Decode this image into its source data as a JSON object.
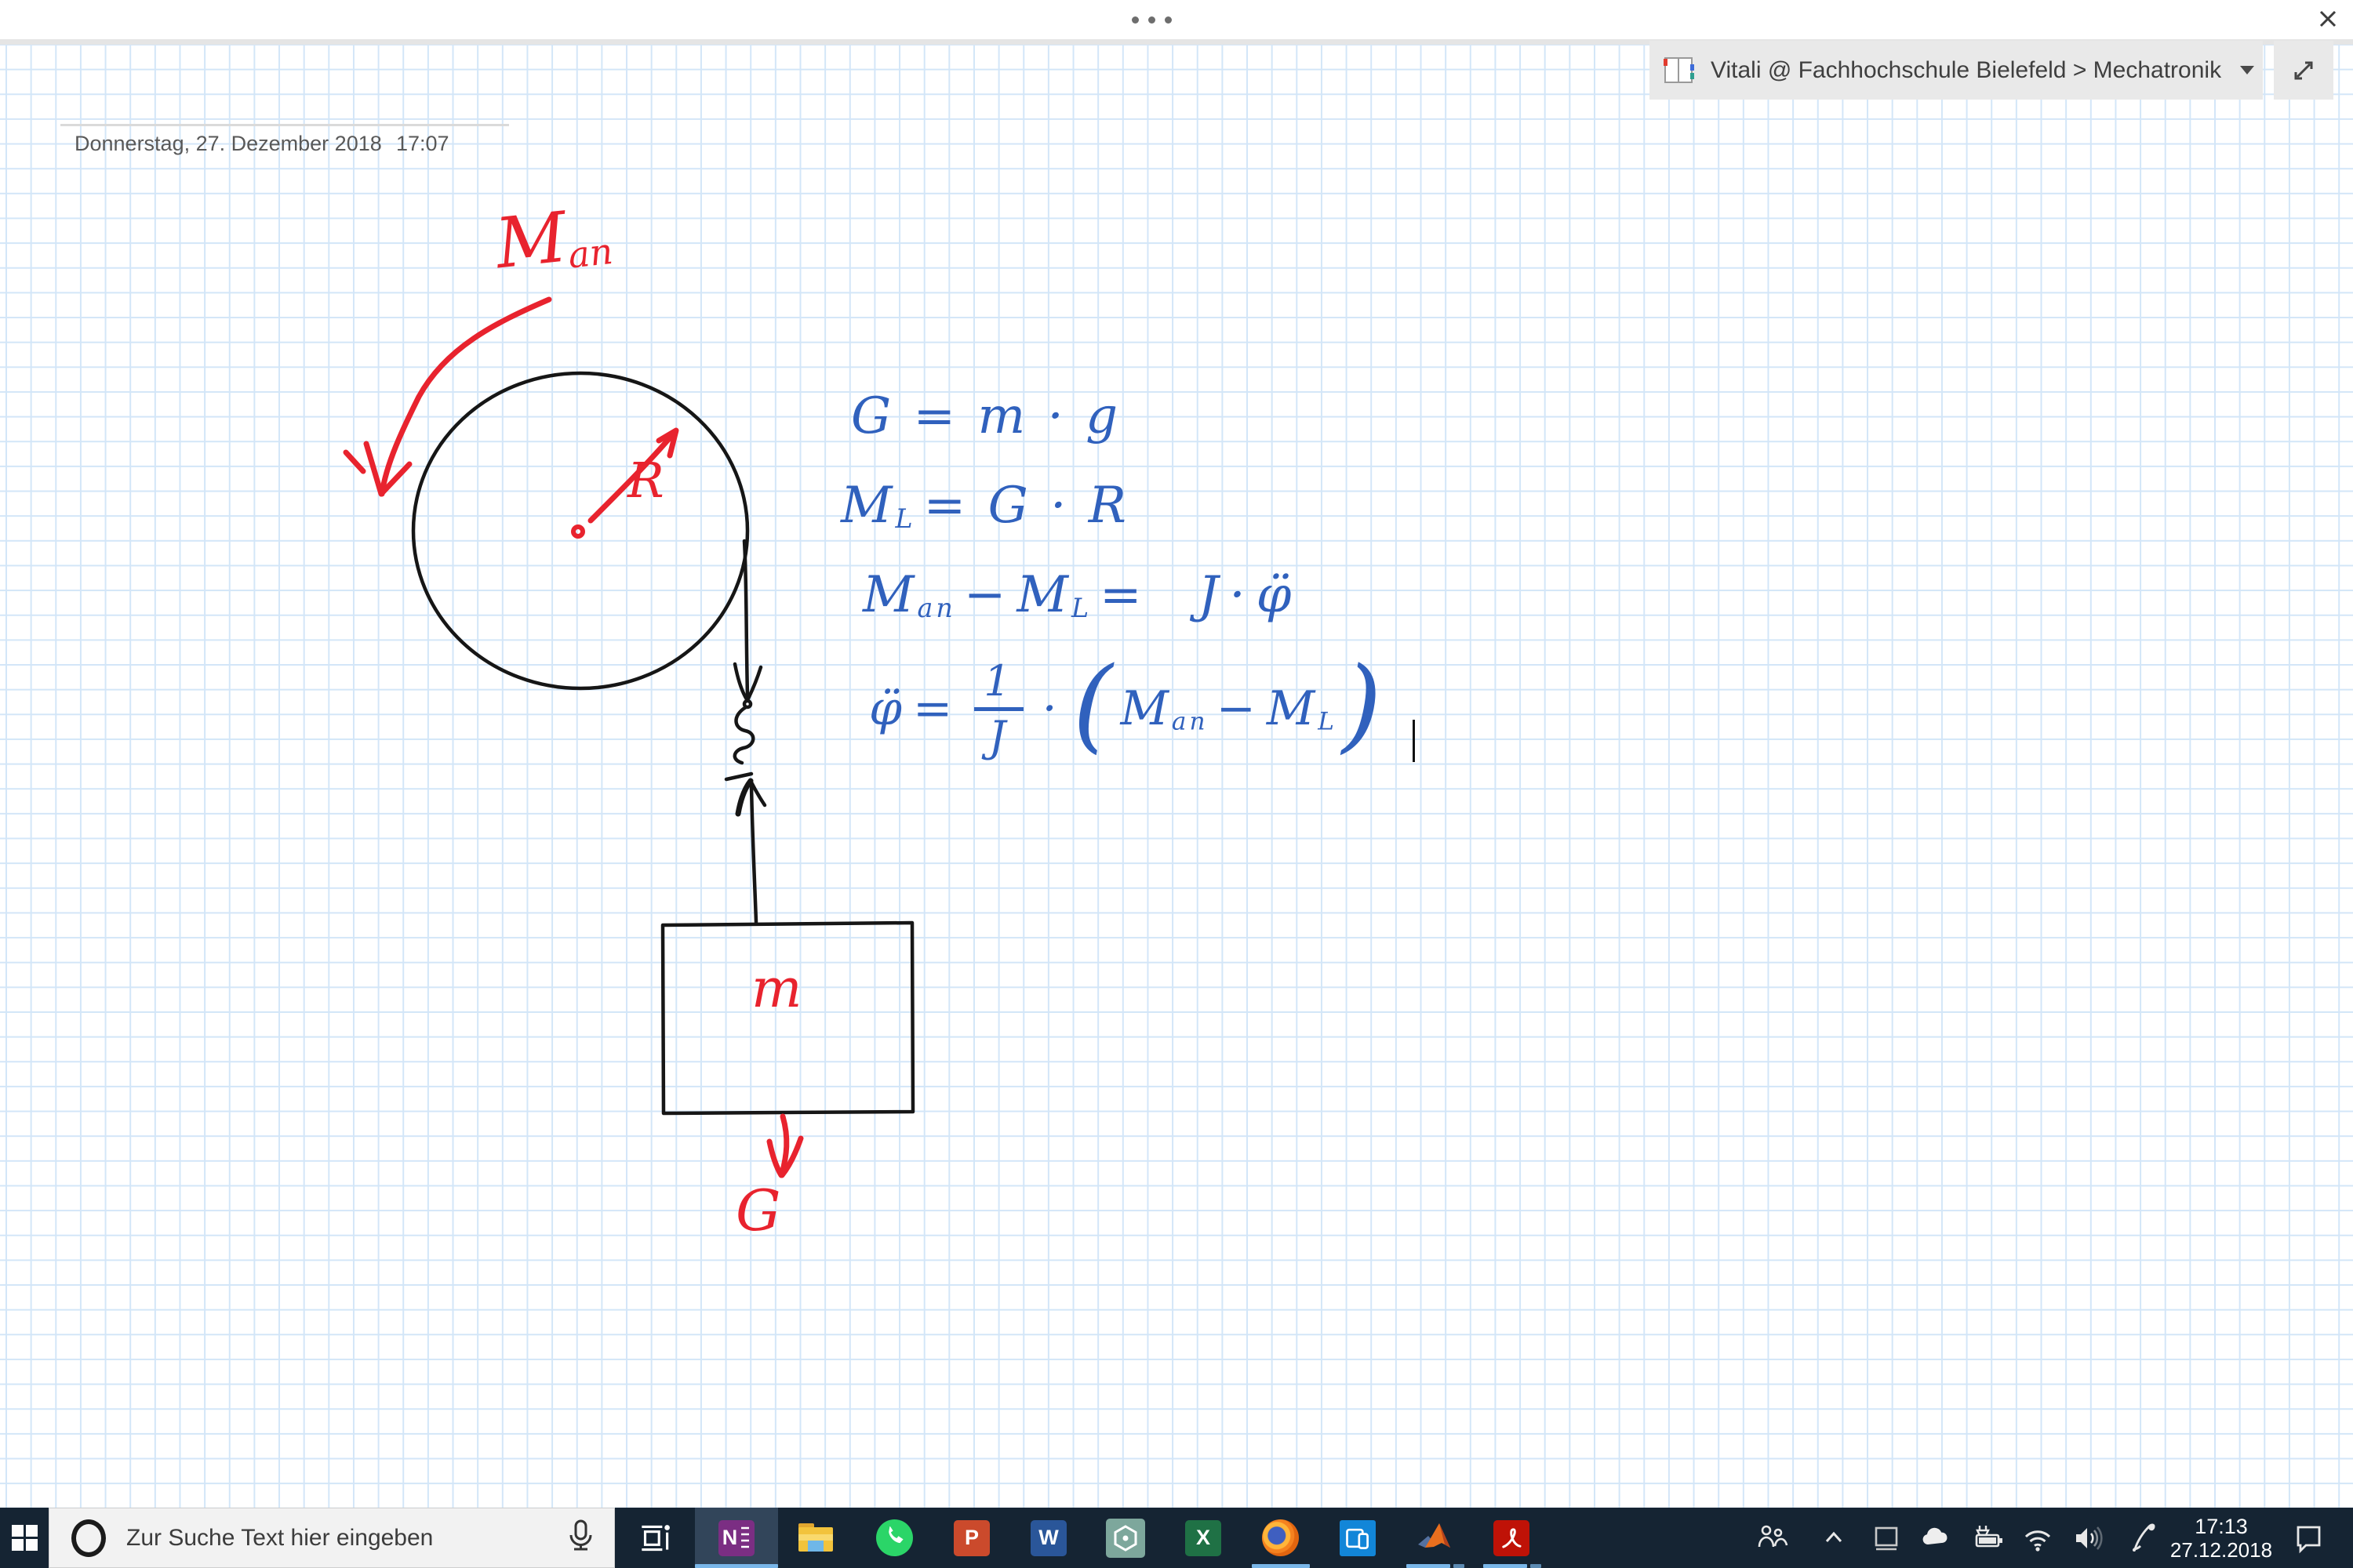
{
  "colors": {
    "ink_red": "#e8232e",
    "ink_blue": "#3061bd",
    "ink_black": "#161616",
    "grid_line": "#d3e6f8",
    "taskbar_bg": "#152433",
    "active_underline": "#79b6e8",
    "notebook_bar_bg": "#e9e9e9"
  },
  "notebook_bar": {
    "title": "Vitali @ Fachhochschule Bielefeld > Mechatronik"
  },
  "page": {
    "date": "Donnerstag, 27. Dezember 2018",
    "time": "17:07"
  },
  "sketch": {
    "labels": {
      "drive_torque_m": "M",
      "drive_torque_sub": "an",
      "radius": "R",
      "mass": "m",
      "weight_force": "G"
    }
  },
  "formulas": {
    "weight": {
      "text": "G = m · g"
    },
    "load_torque": {
      "m": "M",
      "sub": "L",
      "rhs": "= G · R"
    },
    "balance": {
      "m1": "M",
      "sub1": "an",
      "minus": "−",
      "m2": "M",
      "sub2": "L",
      "eq": "=",
      "j": "J",
      "dot": "·",
      "phi": "φ̈"
    },
    "accel": {
      "phi": "φ̈",
      "eq": "=",
      "num": "1",
      "den": "J",
      "dot": "·",
      "open": "(",
      "m1": "M",
      "sub1": "an",
      "minus": "−",
      "m2": "M",
      "sub2": "L",
      "close": ")"
    }
  },
  "taskbar": {
    "search_placeholder": "Zur Suche Text hier eingeben",
    "apps": [
      "task-view",
      "onenote",
      "file-explorer",
      "whatsapp",
      "powerpoint",
      "word",
      "hexagon-app",
      "excel",
      "firefox",
      "your-phone",
      "matlab",
      "acrobat-reader"
    ],
    "active_app": "onenote",
    "running_apps": [
      "onenote",
      "firefox",
      "matlab",
      "acrobat-reader"
    ],
    "app_letters": {
      "onenote": "N",
      "powerpoint": "P",
      "word": "W",
      "excel": "X"
    },
    "tray_icons": [
      "people",
      "show-hidden-chevron",
      "display",
      "onedrive",
      "battery",
      "wifi",
      "volume",
      "pen"
    ],
    "clock": {
      "time": "17:13",
      "date": "27.12.2018"
    }
  }
}
